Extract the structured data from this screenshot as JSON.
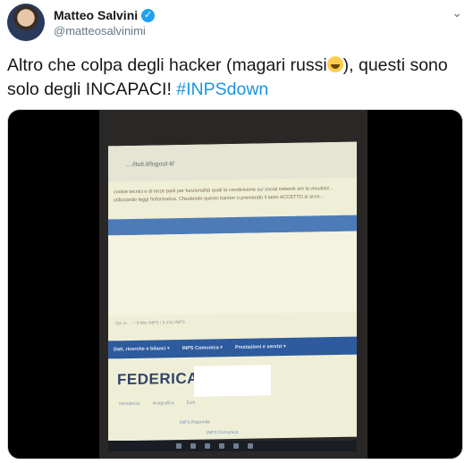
{
  "tweet": {
    "author_name": "Matteo Salvini",
    "handle": "@matteosalvinimi",
    "text_part1": "Altro che colpa degli hacker (magari russi",
    "text_part2": "), questi sono solo degli INCAPACI! ",
    "hashtag": "#INPSdown",
    "emoji": "rolling-on-floor-laughing-icon"
  },
  "video_frame": {
    "address": "…/ituti.it/logout-it/",
    "cookie_notice": "cookie tecnici e di terze parti per funzionalità quali la condivisione sui social network e/o la visualizz… utilizzando leggi l'informativa. Chiudendo questo banner o premendo il tasto ACCETTO si acco…",
    "breadcrumb": "Sei in: ... / Il Mio INPS / Il mio INPS",
    "nav_items": [
      "Dati, ricerche e bilanci ▾",
      "INPS Comunica ▾",
      "Prestazioni e servizi ▾"
    ],
    "user_name": "FEDERICA",
    "sub_links": [
      "Residenza",
      "Anagrafica",
      "Esiti"
    ],
    "lower_link1": "INPS Risponde",
    "lower_link2": "INPS Comunica"
  }
}
